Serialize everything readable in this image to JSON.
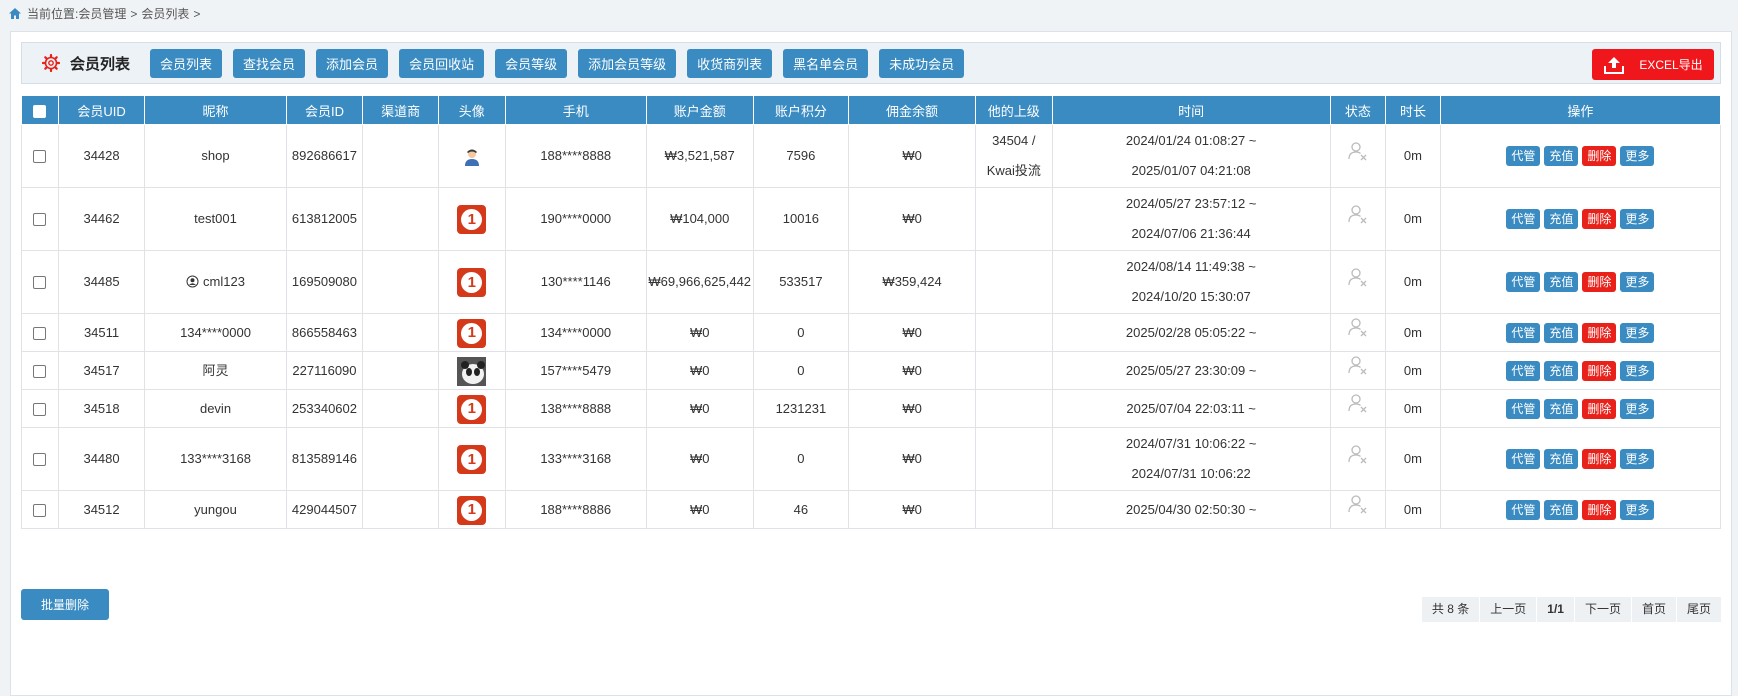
{
  "breadcrumb": {
    "prefix": "当前位置:",
    "items": [
      "会员管理",
      "会员列表"
    ],
    "sep": ">"
  },
  "toolbar": {
    "title": "会员列表",
    "buttons": [
      "会员列表",
      "查找会员",
      "添加会员",
      "会员回收站",
      "会员等级",
      "添加会员等级",
      "收货商列表",
      "黑名单会员",
      "未成功会员"
    ],
    "export_label": "EXCEL导出"
  },
  "table": {
    "headers": [
      "会员UID",
      "昵称",
      "会员ID",
      "渠道商",
      "头像",
      "手机",
      "账户金额",
      "账户积分",
      "佣金余额",
      "他的上级",
      "时间",
      "状态",
      "时长",
      "操作"
    ],
    "ops": [
      "代管",
      "充值",
      "删除",
      "更多"
    ],
    "rows": [
      {
        "uid": "34428",
        "nick": "shop",
        "mid": "892686617",
        "channel": "",
        "avatar": "person",
        "phone": "188****8888",
        "balance": "₩3,521,587",
        "points": "7596",
        "commission": "₩0",
        "parent1": "34504 /",
        "parent2": "Kwai投流",
        "time1": "2024/01/24 01:08:27 ~",
        "time2": "2025/01/07 04:21:08",
        "duration": "0m"
      },
      {
        "uid": "34462",
        "nick": "test001",
        "mid": "613812005",
        "channel": "",
        "avatar": "red",
        "phone": "190****0000",
        "balance": "₩104,000",
        "points": "10016",
        "commission": "₩0",
        "parent1": "",
        "parent2": "",
        "time1": "2024/05/27 23:57:12 ~",
        "time2": "2024/07/06 21:36:44",
        "duration": "0m"
      },
      {
        "uid": "34485",
        "nick": "cml123",
        "mid": "169509080",
        "channel": "",
        "avatar": "red",
        "phone": "130****1146",
        "balance": "₩69,966,625,442",
        "points": "533517",
        "commission": "₩359,424",
        "parent1": "",
        "parent2": "",
        "time1": "2024/08/14 11:49:38 ~",
        "time2": "2024/10/20 15:30:07",
        "duration": "0m"
      },
      {
        "uid": "34511",
        "nick": "134****0000",
        "mid": "866558463",
        "channel": "",
        "avatar": "red",
        "phone": "134****0000",
        "balance": "₩0",
        "points": "0",
        "commission": "₩0",
        "parent1": "",
        "parent2": "",
        "time1": "2025/02/28 05:05:22 ~",
        "time2": "",
        "duration": "0m"
      },
      {
        "uid": "34517",
        "nick": "阿灵",
        "mid": "227116090",
        "channel": "",
        "avatar": "panda",
        "phone": "157****5479",
        "balance": "₩0",
        "points": "0",
        "commission": "₩0",
        "parent1": "",
        "parent2": "",
        "time1": "2025/05/27 23:30:09 ~",
        "time2": "",
        "duration": "0m"
      },
      {
        "uid": "34518",
        "nick": "devin",
        "mid": "253340602",
        "channel": "",
        "avatar": "red",
        "phone": "138****8888",
        "balance": "₩0",
        "points": "1231231",
        "commission": "₩0",
        "parent1": "",
        "parent2": "",
        "time1": "2025/07/04 22:03:11 ~",
        "time2": "",
        "duration": "0m"
      },
      {
        "uid": "34480",
        "nick": "133****3168",
        "mid": "813589146",
        "channel": "",
        "avatar": "red",
        "phone": "133****3168",
        "balance": "₩0",
        "points": "0",
        "commission": "₩0",
        "parent1": "",
        "parent2": "",
        "time1": "2024/07/31 10:06:22 ~",
        "time2": "2024/07/31 10:06:22",
        "duration": "0m"
      },
      {
        "uid": "34512",
        "nick": "yungou",
        "mid": "429044507",
        "channel": "",
        "avatar": "red",
        "phone": "188****8886",
        "balance": "₩0",
        "points": "46",
        "commission": "₩0",
        "parent1": "",
        "parent2": "",
        "time1": "2025/04/30 02:50:30 ~",
        "time2": "",
        "duration": "0m"
      }
    ]
  },
  "avatar_glyph": "1",
  "bulk_delete_label": "批量删除",
  "pager": {
    "total": "共 8 条",
    "prev": "上一页",
    "current": "1/1",
    "next": "下一页",
    "first": "首页",
    "last": "尾页"
  },
  "colors": {
    "primary": "#3a8bc2",
    "danger": "#e8211a",
    "export": "#f0171c"
  }
}
